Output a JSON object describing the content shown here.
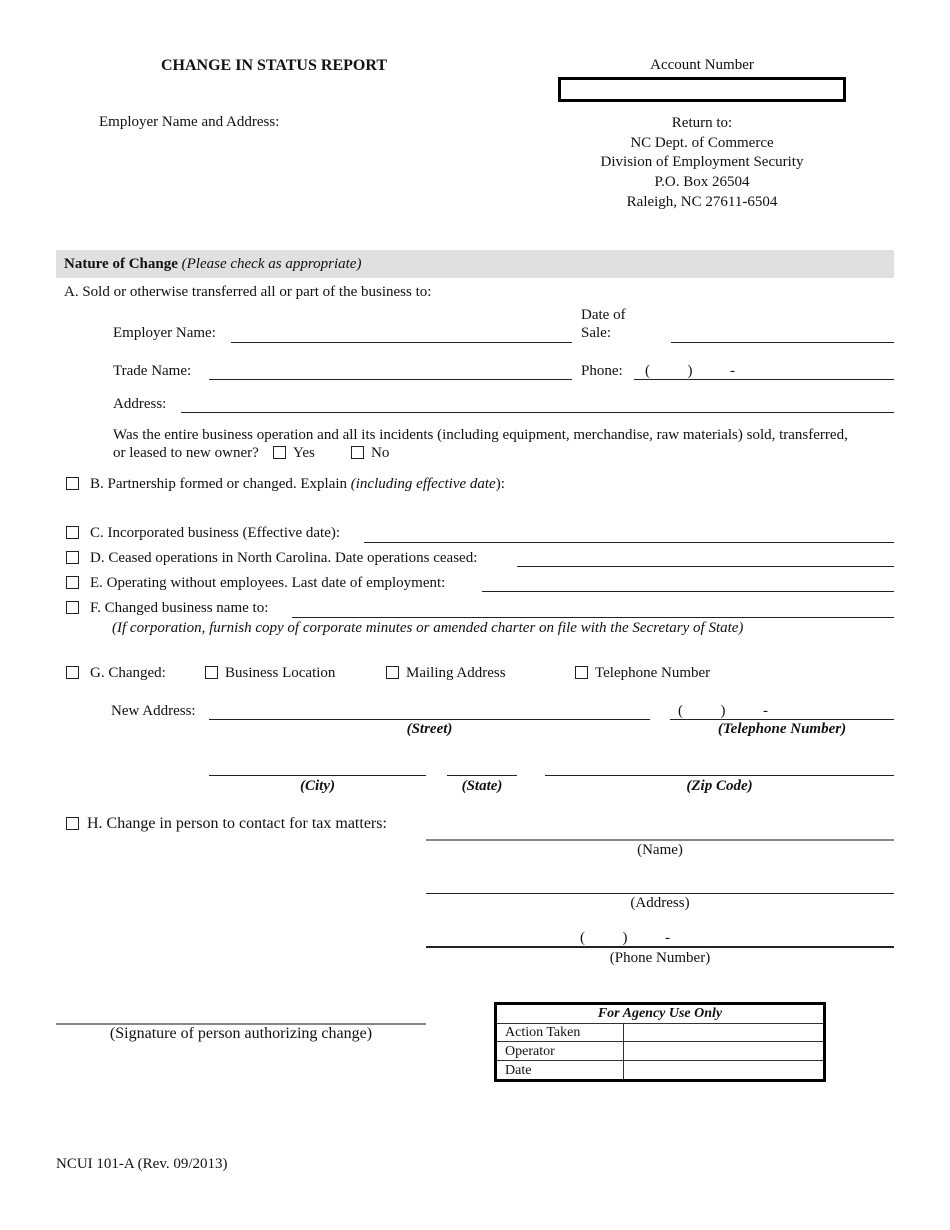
{
  "header": {
    "title": "CHANGE IN STATUS REPORT",
    "account_number_label": "Account Number",
    "account_number_value": "",
    "employer_label": "Employer Name and Address:",
    "return_to": [
      "Return to:",
      "NC Dept. of Commerce",
      "Division of Employment Security",
      "P.O. Box 26504",
      "Raleigh, NC  27611-6504"
    ]
  },
  "section": {
    "title": "Nature of Change",
    "subtitle": "(Please check as appropriate)"
  },
  "item_a": {
    "label": "A.  Sold or otherwise transferred all or part of the business to:",
    "employer_name_label": "Employer Name:",
    "date_of_sale_label_1": "Date of",
    "date_of_sale_label_2": "Sale:",
    "trade_name_label": "Trade Name:",
    "phone_label": "Phone:",
    "phone_template": "(          )          -",
    "address_label": "Address:",
    "question_1": "Was the entire business operation and all its incidents (including equipment, merchandise, raw materials) sold, transferred,",
    "question_2": "or leased to new owner?",
    "yes_label": "Yes",
    "no_label": "No"
  },
  "item_b": {
    "label": "B.  Partnership formed or changed.  Explain ",
    "italic": "(including effective date",
    "tail": "):"
  },
  "item_c": {
    "label": "C.  Incorporated business (Effective date):"
  },
  "item_d": {
    "label": "D.  Ceased operations in North Carolina.  Date operations ceased:"
  },
  "item_e": {
    "label": "E.  Operating without employees.  Last date of employment:"
  },
  "item_f": {
    "label": "F.  Changed business name to:",
    "note": "(If corporation, furnish copy of corporate minutes or amended charter on file with the Secretary of State)"
  },
  "item_g": {
    "label": "G.  Changed:",
    "options": [
      "Business Location",
      "Mailing Address",
      "Telephone Number"
    ],
    "new_address_label": "New Address:",
    "phone_template": "(          )          -",
    "street_caption": "(Street)",
    "telephone_caption": "(Telephone Number)",
    "city_caption": "(City)",
    "state_caption": "(State)",
    "zip_caption": "(Zip Code)"
  },
  "item_h": {
    "label": "H.  Change in person to contact for tax matters:",
    "name_caption": "(Name)",
    "address_caption": "(Address)",
    "phone_template": "(          )          -",
    "phone_caption": "(Phone Number)"
  },
  "signature_caption": "(Signature of person authorizing change)",
  "agency": {
    "title": "For Agency Use Only",
    "rows": [
      "Action Taken",
      "Operator",
      "Date"
    ]
  },
  "footer": "NCUI 101-A (Rev. 09/2013)"
}
